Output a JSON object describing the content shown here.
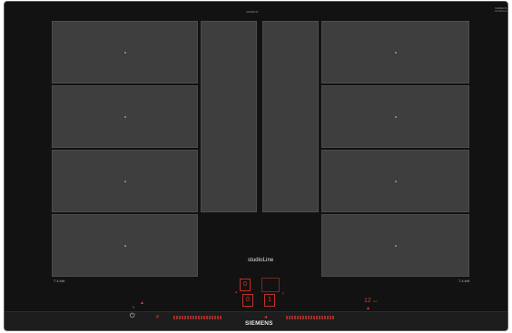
{
  "top_center_text": "SIEMENS",
  "top_right_label": "SIEMENS\nstudioLine",
  "zones": {
    "left_column": [
      "",
      "",
      "",
      ""
    ],
    "center_zones": [
      "",
      ""
    ],
    "right_column": [
      "",
      "",
      "",
      ""
    ]
  },
  "power_labels": {
    "left": "7.4 kW",
    "right": "7.4 kW"
  },
  "studio_line": "studioLine",
  "brand": "SIEMENS",
  "display": {
    "top_digit": "0",
    "bottom_left_digit": "0",
    "bottom_right_digit": "1",
    "timer": "12",
    "timer_unit": "min"
  },
  "controls": {
    "power_icon": "power-icon",
    "slider_left_ticks": 18,
    "slider_right_ticks": 18
  },
  "colors": {
    "hob_background": "#121212",
    "zone_fill": "#3e3e3e",
    "accent_red": "#e0362c"
  }
}
